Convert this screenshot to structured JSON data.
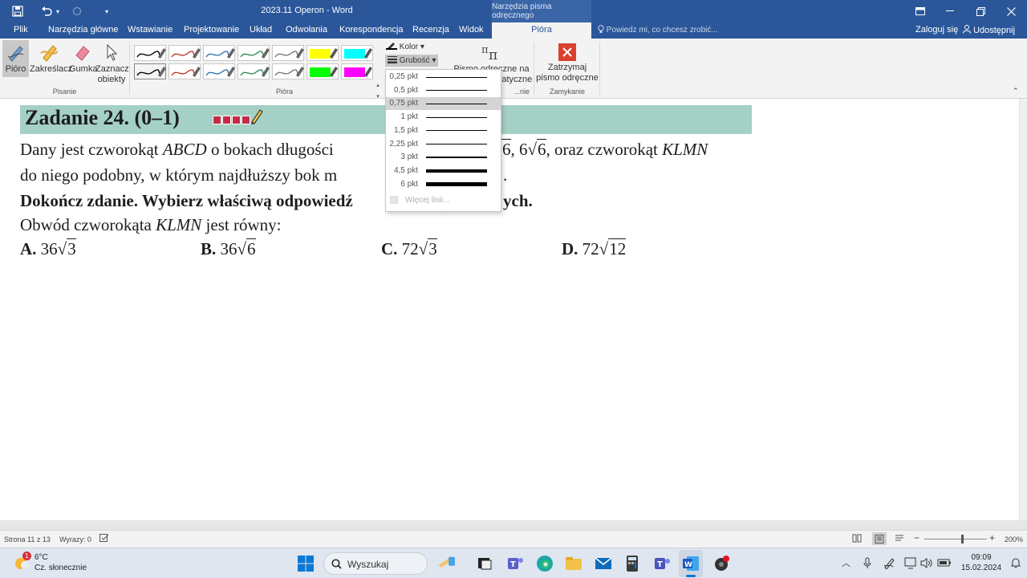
{
  "window": {
    "title": "2023.11 Operon - Word",
    "context_tools": "Narzędzia pisma odręcznego"
  },
  "tabs": [
    "Plik",
    "Narzędzia główne",
    "Wstawianie",
    "Projektowanie",
    "Układ",
    "Odwołania",
    "Korespondencja",
    "Recenzja",
    "Widok",
    "Pióra"
  ],
  "active_tab": "Pióra",
  "tell_me": "Powiedz mi, co chcesz zrobić...",
  "sign_in": "Zaloguj się",
  "share": "Udostępnij",
  "ribbon": {
    "pisanie": {
      "label": "Pisanie",
      "buttons": [
        "Pióro",
        "Zakreślacz",
        "Gumka",
        "Zaznacz obiekty"
      ]
    },
    "piora": {
      "label": "Pióra",
      "color": "Kolor",
      "thickness": "Grubość",
      "pen_colors": [
        "#000000",
        "#c0392b",
        "#2e75b6",
        "#2e8b57",
        "#777777",
        "#ffff00",
        "#00ffff",
        "#000000",
        "#c0392b",
        "#2e75b6",
        "#2e8b57",
        "#777777",
        "#00ff00",
        "#ff00ff"
      ]
    },
    "math": {
      "label_line1": "Pismo odręczne na",
      "label_line2": "matematyczne",
      "group": "...nie"
    },
    "close": {
      "label_line1": "Zatrzymaj",
      "label_line2": "pismo odręczne",
      "group": "Zamykanie"
    }
  },
  "thickness_menu": {
    "items": [
      {
        "label": "0,25 pkt",
        "weight": 0.25
      },
      {
        "label": "0,5 pkt",
        "weight": 0.5
      },
      {
        "label": "0,75 pkt",
        "weight": 0.75
      },
      {
        "label": "1 pkt",
        "weight": 1
      },
      {
        "label": "1,5 pkt",
        "weight": 1.5
      },
      {
        "label": "2,25 pkt",
        "weight": 2.25
      },
      {
        "label": "3 pkt",
        "weight": 3
      },
      {
        "label": "4,5 pkt",
        "weight": 4.5
      },
      {
        "label": "6 pkt",
        "weight": 6
      }
    ],
    "selected": "0,75 pkt",
    "more": "Więcej linii..."
  },
  "document": {
    "task_title": "Zadanie 24. (0–1)",
    "line1_a": "Dany jest czworokąt ",
    "line1_abcd": "ABCD",
    "line1_b": " o bokach długości",
    "line1_c": "6, 6",
    "line1_d": "6, oraz czworokąt ",
    "line1_klmn": "KLMN",
    "line2_a": "do niego podobny, w którym najdłuższy bok m",
    "line2_b": ".",
    "line3_a": "Dokończ zdanie. Wybierz właściwą odpowiedź",
    "line3_b": "ych.",
    "line4_a": "Obwód czworokąta ",
    "line4_klmn": "KLMN",
    "line4_b": " jest równy:",
    "answers": [
      {
        "letter": "A.",
        "coef": "36",
        "radicand": "3"
      },
      {
        "letter": "B.",
        "coef": "36",
        "radicand": "6"
      },
      {
        "letter": "C.",
        "coef": "72",
        "radicand": "3"
      },
      {
        "letter": "D.",
        "coef": "72",
        "radicand": "12"
      }
    ]
  },
  "status": {
    "page": "Strona 11 z 13",
    "words": "Wyrazy: 0",
    "zoom": "200%"
  },
  "taskbar": {
    "weather_temp": "6°C",
    "weather_desc": "Cz. słonecznie",
    "weather_badge": "1",
    "search": "Wyszukaj",
    "time": "09:09",
    "date": "15.02.2024"
  }
}
